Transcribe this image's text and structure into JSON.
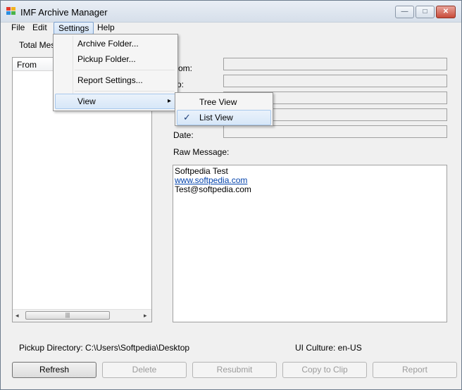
{
  "window": {
    "title": "IMF Archive Manager",
    "minimize": "—",
    "maximize": "□",
    "close": "✕"
  },
  "menubar": {
    "file": "File",
    "edit": "Edit",
    "settings": "Settings",
    "help": "Help"
  },
  "main": {
    "total_label": "Total Mes",
    "list_column": "From",
    "scroll_grip": "|||",
    "scroll_left": "◂",
    "scroll_right": "▸",
    "from_label": "rom:",
    "to_label": "o:",
    "date_label": "Date:",
    "raw_label": "Raw Message:",
    "raw_lines": [
      "Softpedia Test",
      "www.softpedia.com",
      "Test@softpedia.com"
    ]
  },
  "status": {
    "pickup": "Pickup Directory: C:\\Users\\Softpedia\\Desktop",
    "culture": "UI Culture: en-US"
  },
  "buttons": {
    "refresh": "Refresh",
    "delete": "Delete",
    "resubmit": "Resubmit",
    "copy": "Copy to Clip",
    "report": "Report"
  },
  "settings_menu": {
    "archive": "Archive Folder...",
    "pickup": "Pickup Folder...",
    "report": "Report Settings...",
    "view": "View",
    "arrow": "▸"
  },
  "view_menu": {
    "tree": "Tree View",
    "list": "List View",
    "check": "✓"
  },
  "colors": {
    "accent": "#7da2ce",
    "link": "#0645ad",
    "close": "#c84b3a"
  }
}
